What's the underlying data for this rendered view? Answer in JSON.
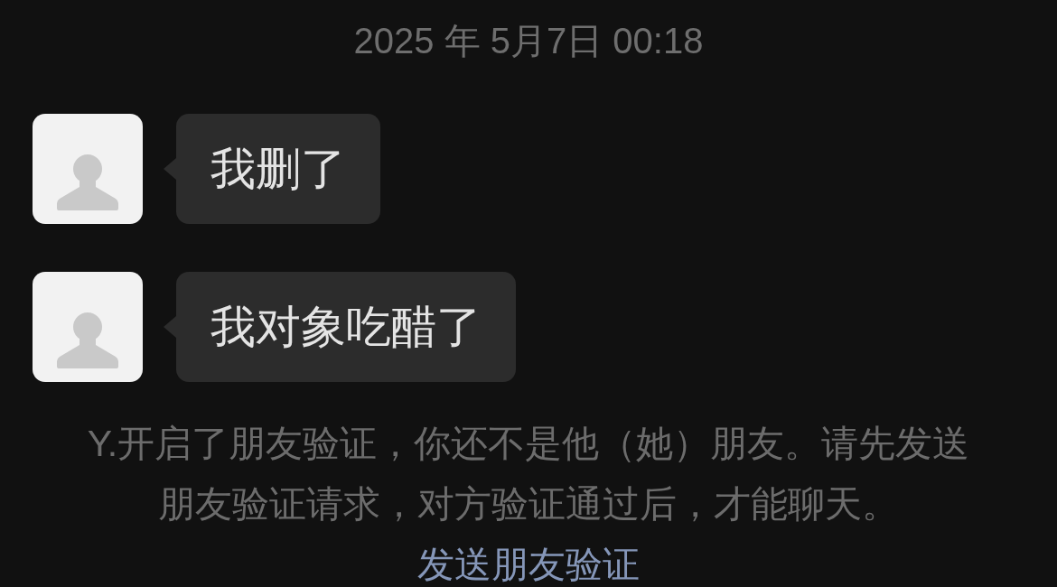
{
  "timestamp": "2025 年 5月7日 00:18",
  "messages": [
    {
      "kind": "incoming",
      "text": "我删了"
    },
    {
      "kind": "incoming",
      "text": "我对象吃醋了"
    }
  ],
  "system_notice": {
    "text": "Y.开启了朋友验证，你还不是他（她）朋友。请先发送朋友验证请求，对方验证通过后，才能聊天。",
    "link": "发送朋友验证"
  }
}
